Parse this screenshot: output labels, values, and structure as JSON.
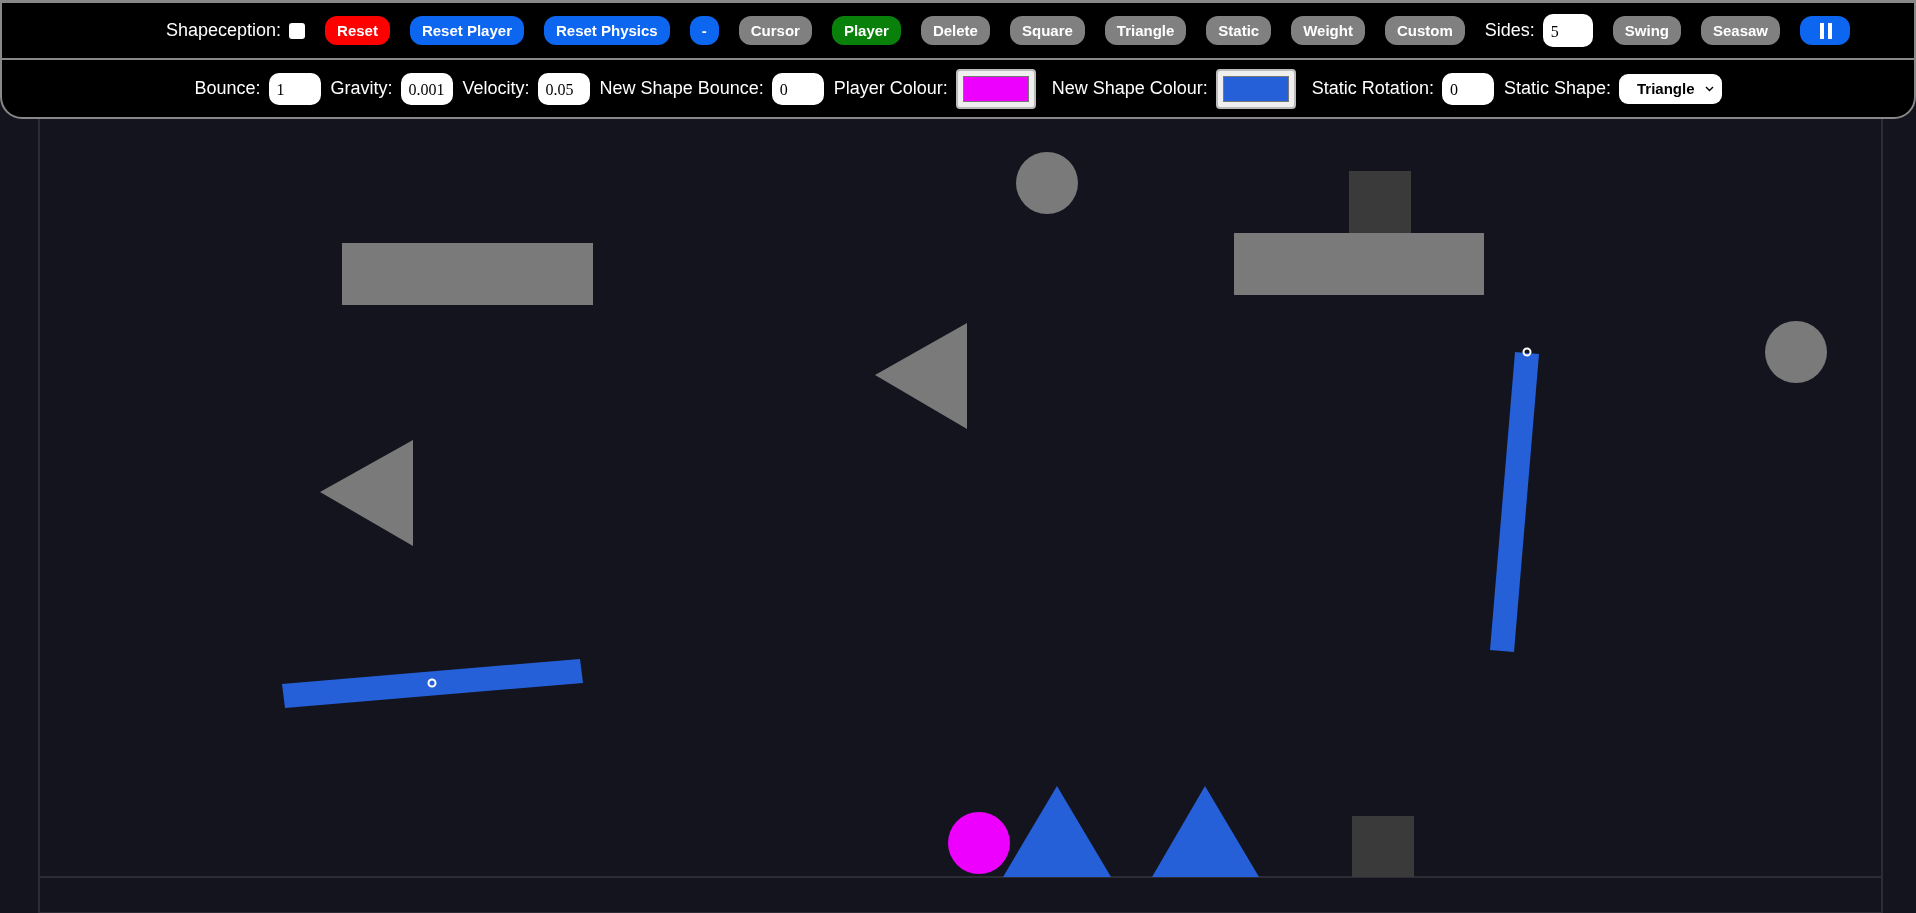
{
  "toolbar": [
    {
      "kind": "checkbox",
      "label": "Shapeception:",
      "checked": false
    },
    {
      "kind": "danger",
      "label": "Reset"
    },
    {
      "kind": "action",
      "label": "Reset Player"
    },
    {
      "kind": "action",
      "label": "Reset Physics"
    },
    {
      "kind": "action",
      "label": "-"
    },
    {
      "kind": "mode",
      "label": "Cursor",
      "selected": false
    },
    {
      "kind": "mode",
      "label": "Player",
      "selected": true
    },
    {
      "kind": "mode",
      "label": "Delete",
      "selected": false
    },
    {
      "kind": "mode",
      "label": "Square",
      "selected": false
    },
    {
      "kind": "mode",
      "label": "Triangle",
      "selected": false
    },
    {
      "kind": "mode",
      "label": "Static",
      "selected": false
    },
    {
      "kind": "mode",
      "label": "Weight",
      "selected": false
    },
    {
      "kind": "mode",
      "label": "Custom",
      "selected": false
    },
    {
      "kind": "field",
      "label": "Sides:",
      "value": "5"
    },
    {
      "kind": "mode",
      "label": "Swing",
      "selected": false
    },
    {
      "kind": "mode",
      "label": "Seasaw",
      "selected": false
    },
    {
      "kind": "pause"
    }
  ],
  "settings": [
    {
      "kind": "field",
      "label": "Bounce:",
      "value": "1"
    },
    {
      "kind": "field",
      "label": "Gravity:",
      "value": "0.001"
    },
    {
      "kind": "field",
      "label": "Velocity:",
      "value": "0.05"
    },
    {
      "kind": "field",
      "label": "New Shape Bounce:",
      "value": "0"
    },
    {
      "kind": "color",
      "label": "Player Colour:",
      "color": "#ee00ff"
    },
    {
      "kind": "color",
      "label": "New Shape Colour:",
      "color": "#2560d8"
    },
    {
      "kind": "field",
      "label": "Static Rotation:",
      "value": "0"
    },
    {
      "kind": "select",
      "label": "Static Shape:",
      "value": "Triangle"
    }
  ]
}
